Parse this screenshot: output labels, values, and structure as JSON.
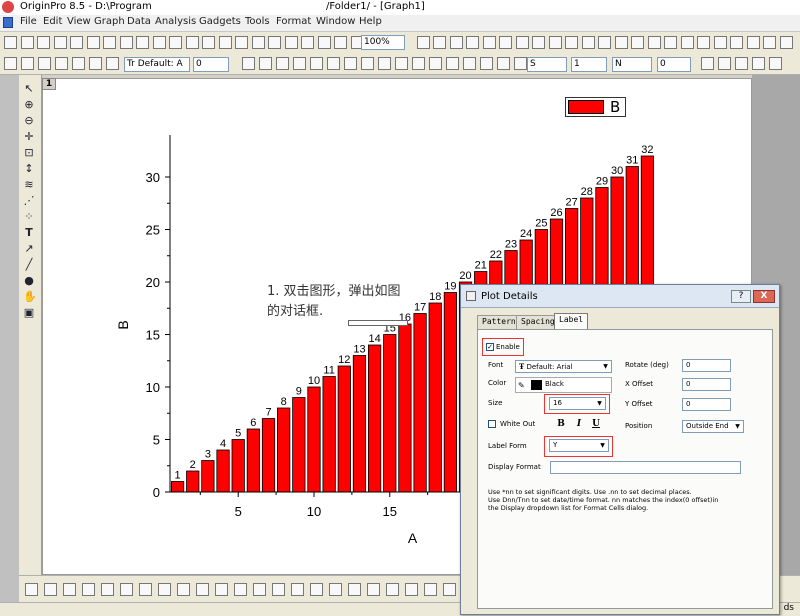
{
  "window": {
    "title_left": "OriginPro 8.5 - D:\\Program",
    "title_right": "/Folder1/ - [Graph1]"
  },
  "menu": {
    "items": [
      "File",
      "Edit",
      "View",
      "Graph",
      "Data",
      "Analysis",
      "Gadgets",
      "Tools",
      "Format",
      "Window",
      "Help"
    ]
  },
  "toolbar": {
    "zoom": "100%",
    "font_combo": "Tr Default: A",
    "size_combo": "0",
    "line_style_combo": "S",
    "line_width_combo": "1",
    "fill_combo": "N",
    "pattern_combo": "0"
  },
  "graph": {
    "layer_number": "1",
    "legend_label": "B",
    "note_text": "1. 双击图形，弹出如图\n的对话框."
  },
  "status": {
    "right_text": "ds"
  },
  "chart_data": {
    "type": "bar",
    "x": [
      1,
      2,
      3,
      4,
      5,
      6,
      7,
      8,
      9,
      10,
      11,
      12,
      13,
      14,
      15,
      16,
      17,
      18,
      19,
      20,
      21,
      22,
      23,
      24,
      25,
      26,
      27,
      28,
      29,
      30,
      31,
      32
    ],
    "values": [
      1,
      2,
      3,
      4,
      5,
      6,
      7,
      8,
      9,
      10,
      11,
      12,
      13,
      14,
      15,
      16,
      17,
      18,
      19,
      20,
      21,
      22,
      23,
      24,
      25,
      26,
      27,
      28,
      29,
      30,
      31,
      32
    ],
    "data_labels": [
      "1",
      "2",
      "3",
      "4",
      "5",
      "6",
      "7",
      "8",
      "9",
      "10",
      "11",
      "12",
      "13",
      "14",
      "15",
      "16",
      "17",
      "18",
      "19",
      "20",
      "21",
      "22",
      "23",
      "24",
      "25",
      "26",
      "27",
      "28",
      "29",
      "30",
      "31",
      "32"
    ],
    "xlabel": "A",
    "ylabel": "B",
    "x_ticks": [
      "5",
      "10",
      "15"
    ],
    "y_ticks": [
      "0",
      "5",
      "10",
      "15",
      "20",
      "25",
      "30"
    ],
    "ylim": [
      0,
      34
    ],
    "bar_color": "#ff0000",
    "legend": [
      "B"
    ]
  },
  "dialog": {
    "title": "Plot Details",
    "help_button": "?",
    "close_button": "X",
    "tabs": [
      "Pattern",
      "Spacing",
      "Label"
    ],
    "enable_label": "Enable",
    "font_label": "Font",
    "font_value": "Default: Arial",
    "color_label": "Color",
    "color_value": "Black",
    "size_label": "Size",
    "size_value": "16",
    "white_out_label": "White Out",
    "bold_button": "B",
    "italic_button": "I",
    "underline_button": "U",
    "label_form_label": "Label Form",
    "label_form_value": "Y",
    "display_format_label": "Display Format",
    "display_format_value": "",
    "rotate_label": "Rotate (deg)",
    "rotate_value": "0",
    "xoffset_label": "X Offset",
    "xoffset_value": "0",
    "yoffset_label": "Y Offset",
    "yoffset_value": "0",
    "position_label": "Position",
    "position_value": "Outside End",
    "help_text": "Use *nn to set significant digits. Use .nn to set decimal places.\nUse Dnn/Tnn to set date/time format. nn matches the index(0 offset)in\nthe Display dropdown list for Format Cells dialog."
  }
}
